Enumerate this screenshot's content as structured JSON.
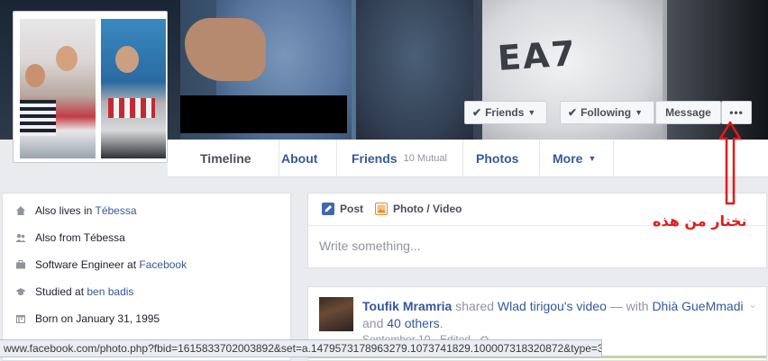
{
  "header": {
    "buttons": {
      "friends": "Friends",
      "following": "Following",
      "message": "Message",
      "more": "•••"
    },
    "tabs": {
      "timeline": "Timeline",
      "about": "About",
      "friends": "Friends",
      "friends_mutual": "10 Mutual",
      "photos": "Photos",
      "more": "More"
    }
  },
  "intro": {
    "items": [
      {
        "prefix": "Also lives in ",
        "link": "Tébessa",
        "icon": "home-icon"
      },
      {
        "prefix": "Also from Tébessa",
        "link": "",
        "icon": "people-icon"
      },
      {
        "prefix": "Software Engineer at ",
        "link": "Facebook",
        "icon": "briefcase-icon"
      },
      {
        "prefix": "Studied at ",
        "link": "ben badis",
        "icon": "graduation-cap-icon"
      },
      {
        "prefix": "Born on January 31, 1995",
        "link": "",
        "icon": "calendar-icon"
      }
    ]
  },
  "composer": {
    "post_label": "Post",
    "photo_label": "Photo / Video",
    "placeholder": "Write something..."
  },
  "post": {
    "author": "Toufik Mrамria",
    "author_display": "Toufik Mramria",
    "action": "shared",
    "source": "Wlad tirigou",
    "source_suffix": "'s video",
    "with_text": " — with ",
    "tag1": "Dhià GueMmadi",
    "and_text": " and ",
    "others": "40 others",
    "end": ".",
    "meta": "September 10 · Edited · "
  },
  "annotation": {
    "arabic": "نختار من هذه"
  },
  "statusbar": {
    "url": "www.facebook.com/photo.php?fbid=1615833702003892&set=a.1479573178963279.1073741829.100007318320872&type=3"
  },
  "colors": {
    "link": "#365899",
    "annotation_red": "#e21b1b"
  }
}
